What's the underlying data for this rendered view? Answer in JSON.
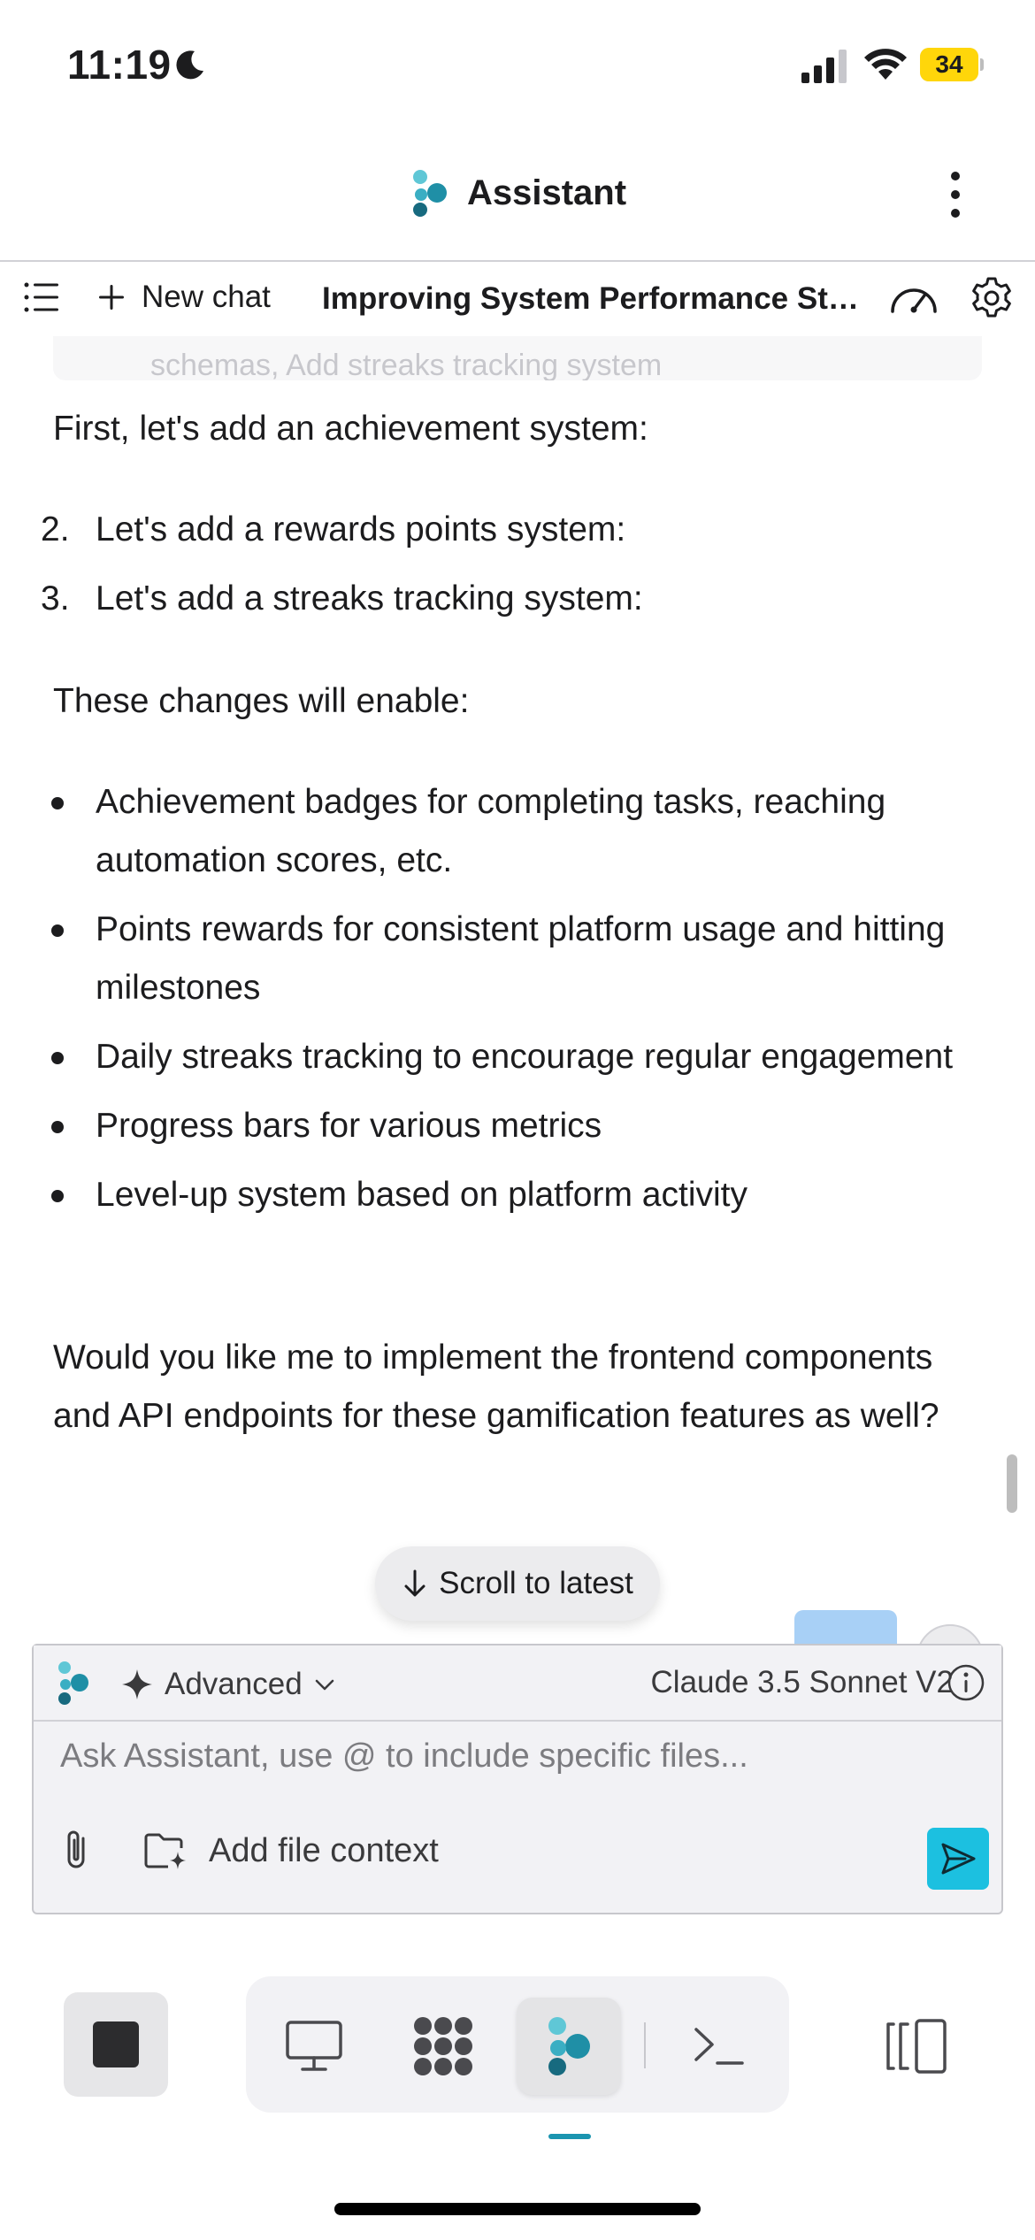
{
  "status_bar": {
    "time": "11:19",
    "battery": "34",
    "battery_level": 0.34,
    "battery_color": "#ffd60a"
  },
  "header": {
    "title": "Assistant",
    "logo_icon": "assistant-logo-icon",
    "menu_icon": "more-vertical-icon"
  },
  "toolbar": {
    "new_chat_label": "New chat",
    "chat_title": "Improving System Performance Str..."
  },
  "conversation": {
    "faded_text": "schemas, Add streaks tracking system",
    "intro": "First, let's add an achievement system:",
    "numbered": [
      {
        "num": "2.",
        "text": "Let's add a rewards points system:"
      },
      {
        "num": "3.",
        "text": "Let's add a streaks tracking system:"
      }
    ],
    "enable_heading": "These changes will enable:",
    "bullets": [
      "Achievement badges for completing tasks, reaching automation scores, etc.",
      "Points rewards for consistent platform usage and hitting milestones",
      "Daily streaks tracking to encourage regular engagement",
      "Progress bars for various metrics",
      "Level-up system based on platform activity"
    ],
    "question": "Would you like me to implement the frontend components and API endpoints for these gamification features as well?"
  },
  "scroll_latest": {
    "label": "Scroll to latest"
  },
  "composer": {
    "mode_label": "Advanced",
    "model_label": "Claude 3.5 Sonnet V2",
    "placeholder": "Ask Assistant, use @ to include specific files...",
    "add_context_label": "Add file context",
    "accent_color": "#1cc0e0"
  },
  "dock": {
    "items": [
      "desktop-icon",
      "apps-grid-icon",
      "assistant-icon",
      "terminal-icon"
    ],
    "active": "assistant-icon",
    "accent_color": "#1b95b0"
  }
}
